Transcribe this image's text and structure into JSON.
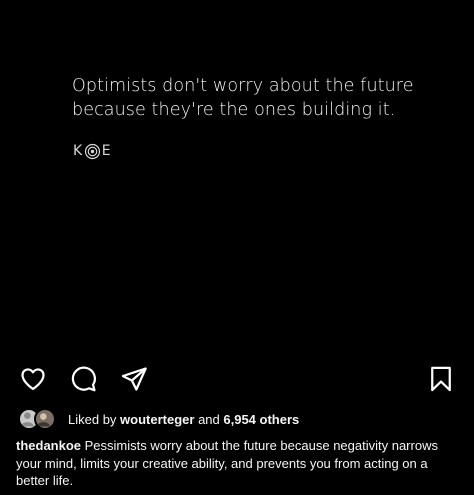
{
  "post": {
    "quote_line_1": "Optimists don't worry about the future",
    "quote_line_2": "because they're the ones building it.",
    "brand_k": "K",
    "brand_e": "E",
    "brand_logo": "koe-target-logo"
  },
  "actions": {
    "like_icon": "heart-outline-icon",
    "comment_icon": "comment-bubble-icon",
    "share_icon": "paper-plane-icon",
    "save_icon": "bookmark-outline-icon"
  },
  "likes": {
    "prefix": "Liked by ",
    "user": "wouterteger",
    "connector": " and ",
    "count": "6,954 others"
  },
  "caption": {
    "username": "thedankoe",
    "text": " Pessimists worry about the future because negativity narrows your mind, limits your creative ability, and prevents you from acting on a better life."
  },
  "colors": {
    "background": "#000000",
    "text": "#ffffff",
    "quote_text": "#f2f2f2"
  }
}
